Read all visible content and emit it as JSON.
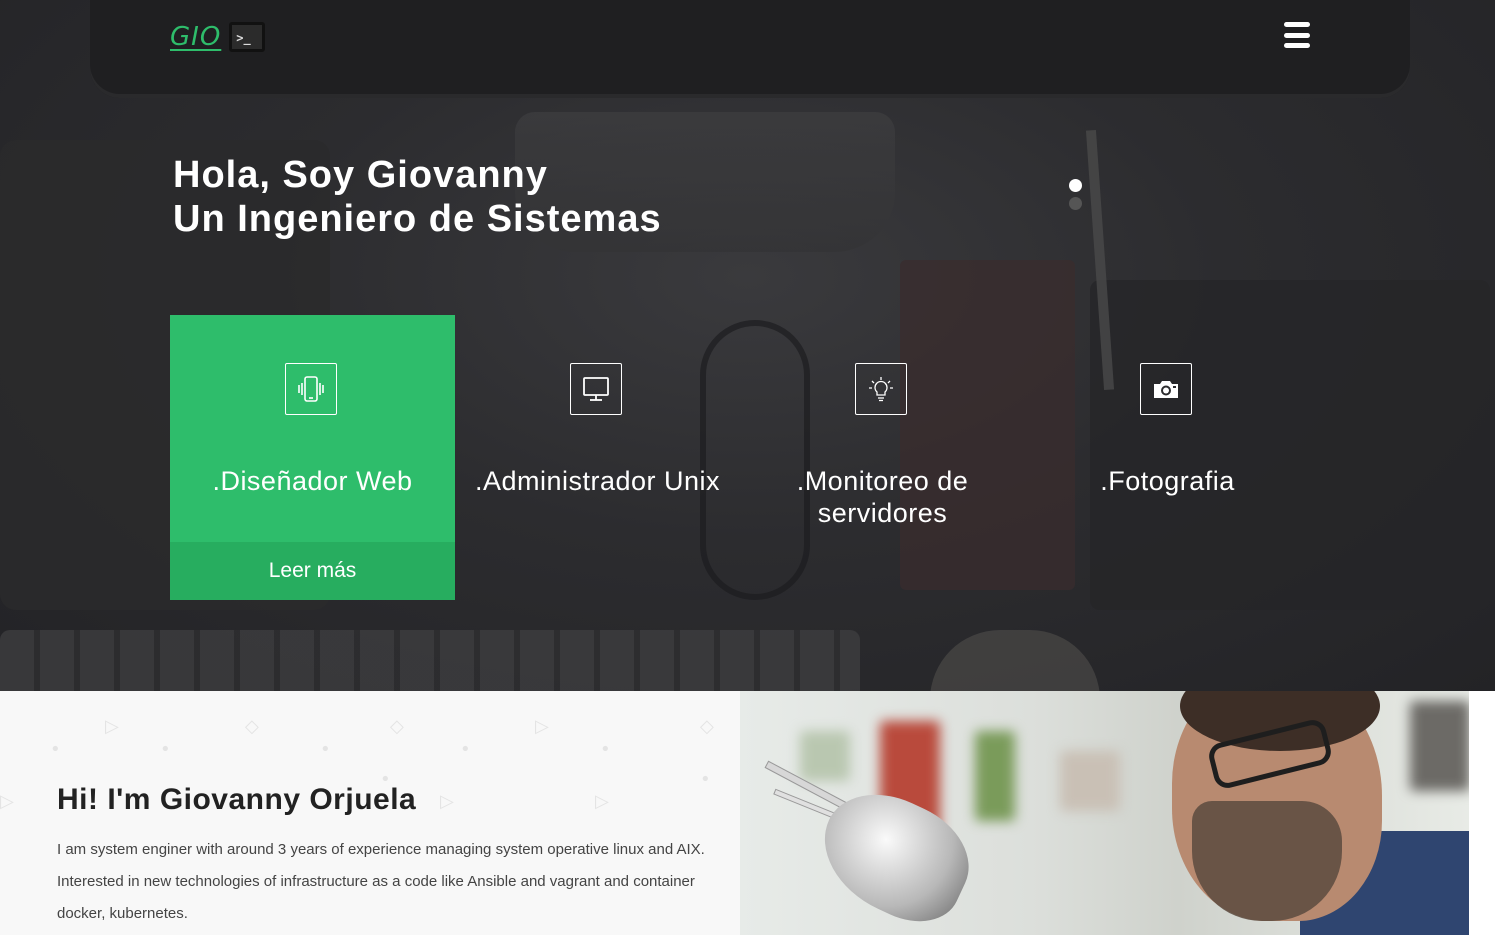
{
  "header": {
    "logo_text": "GIO",
    "logo_terminal_prompt": ">_",
    "menu_icon": "hamburger-menu-icon"
  },
  "hero": {
    "line1_prefix": "Hola, Soy ",
    "line1_bold": "Giovanny",
    "line2_prefix": "Un ",
    "line2_bold": "Ingeniero",
    "line2_suffix": " de Sistemas",
    "slider_dots": 2,
    "active_dot": 1
  },
  "services": [
    {
      "title": ".Diseñador Web",
      "icon": "responsive-device-icon",
      "active": true,
      "more_label": "Leer más"
    },
    {
      "title": ".Administrador Unix",
      "icon": "desktop-monitor-icon",
      "active": false
    },
    {
      "title": ".Monitoreo de servidores",
      "icon": "lightbulb-idea-icon",
      "active": false
    },
    {
      "title": ".Fotografia",
      "icon": "camera-icon",
      "active": false
    }
  ],
  "about": {
    "title_prefix": "Hi! I'm ",
    "title_bold": "Giovanny Orjuela",
    "text": "I am system enginer with around 3 years of experience managing system operative linux and AIX. Interested in new technologies of infrastructure as a code like Ansible and vagrant and container docker, kubernetes."
  },
  "colors": {
    "accent": "#2ebd6b",
    "accent_dark": "#27ad5f",
    "hero_bg": "#2c2c2f",
    "about_bg": "#f8f8f8"
  }
}
